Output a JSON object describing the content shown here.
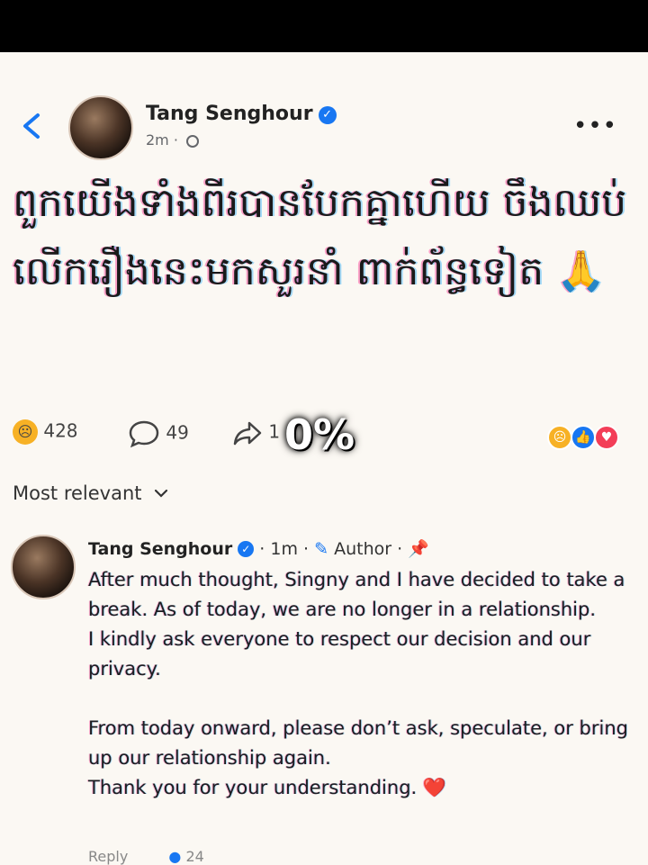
{
  "post": {
    "author": "Tang Senghour",
    "time": "2m",
    "verified_mark": "✓",
    "text": "ពួកយើងទាំងពីរបានបែកគ្នាហើយ ចឹងឈប់លើករឿងនេះមកសួរនាំ ពាក់ព័ន្ធទៀត 🙏"
  },
  "actions": {
    "reactions_count": "428",
    "comments_count": "49",
    "shares_count": "1",
    "overlay_percent": "0%"
  },
  "sort": {
    "label": "Most relevant"
  },
  "comment": {
    "author": "Tang Senghour",
    "time": "1m",
    "author_badge": "Author",
    "lines": [
      "After much thought, Singny and I have decided to take a break. As of today, we are no longer in a relationship.",
      "I kindly ask everyone to respect our decision and our privacy.",
      "From today onward, please don’t ask, speculate, or bring up our relationship again.",
      "Thank you for your understanding. ❤️"
    ],
    "footer_reply": "Reply",
    "footer_count": "24"
  },
  "colors": {
    "accent": "#1877f2",
    "background": "#fbf8f3",
    "topbar": "#000000"
  }
}
